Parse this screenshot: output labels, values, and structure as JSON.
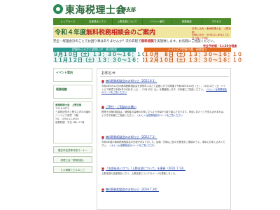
{
  "header": {
    "org_name": "東海税理士会",
    "branch": "上野支部"
  },
  "nav": {
    "items": [
      "トップページ",
      "支部長あいさつ",
      "上野支部について",
      "イベント案内",
      "税務相談",
      "アクセス"
    ]
  },
  "banner": {
    "year": "令和４年度",
    "title": "無料税務相談会のご案内",
    "contact_lines": [
      "お申し込み・東海税理士会　上野支部",
      "お問い合せ　0595-21-6910（平日 9時～17時）"
    ]
  },
  "note": {
    "text_before": "完全・経理会計のことでお困り事はありませんか？次の日程で",
    "highlight": "無料相談",
    "text_after": "を実施致します。お気軽にご相談ください。",
    "right": "完全予約制・1人30分程度"
  },
  "schedule_left": {
    "heading": "伊賀市ふるさと会館いが　多目的室",
    "rows": [
      "９月１０日（土）１３：３０～１６：１０",
      "１１月１２日（土）１３：３０～１６：１０"
    ]
  },
  "schedule_right": {
    "heading": "ハイトピア伊賀３階　研修室２",
    "rows": [
      "１０月　８日（土）１３：３０～１６：１０",
      "１２月１０日（土）１３：３０～１６：１０"
    ]
  },
  "sidebar": {
    "event_heading": "イベント案内",
    "tax_heading": "税務相談",
    "address_lines": [
      "東海税理士会　上野支部",
      "〒518-0873",
      "三重県伊賀市上野丸之内500番地",
      "ハイトピア伊賀　5階",
      "TEL　0595-21-6910",
      "営業時間　平日 9時～17時"
    ],
    "buttons": [
      "確定申告書等作成コーナー",
      "税理士会「税務相談」",
      "ビル情報とビルのこと"
    ]
  },
  "main": {
    "title": "お知らせ",
    "news": [
      {
        "mark": "■",
        "title": "無料税務相談会のお知らせ（2022.8.1）",
        "body_plain": "令和4年9月10日の無料税務相談会を伊賀市ふるさと会館いがでの開催で令和4年9月10日（土）、11月12日（土）ハイトピア伊賀で令和4年10月8日（土）、12月10日（土）を開催致します。お気軽にご相談ください。",
        "body_link": "くわしくは税務相談のページをご覧ください"
      },
      {
        "mark": "■",
        "title": "ご寄付・ご相談のお願い",
        "body_plain": "税理士の無料相談は、納税者の皆様のお役に立つよう日頃から取り組んでおります。申告にあたって不安な点があれば、どうぞお気軽にご相談ください。",
        "body_link": "くわしくは税務相談のページをご覧ください"
      },
      {
        "mark": "■",
        "title": "無料税務相談会のお知らせ（2022.7.1）",
        "body_plain": "令和4年度の無料税務相談会の日程が決まりました。会場・日時は上記の日程表をご確認のうえ、事前にお申し込みください。",
        "body_link": "くわしくは税務相談のページをご覧ください"
      },
      {
        "mark": "■",
        "title": "「支部長あいさつ」「上野支部について」を更新（2021.7.13）",
        "body_plain": "上野支部の支部長あいさつ、上野支部についてのページを更新しました。",
        "body_link": ""
      },
      {
        "mark": "■",
        "title": "無料税務相談会のお知らせ（2019.7.30）",
        "body_plain": "",
        "body_link": ""
      }
    ]
  }
}
